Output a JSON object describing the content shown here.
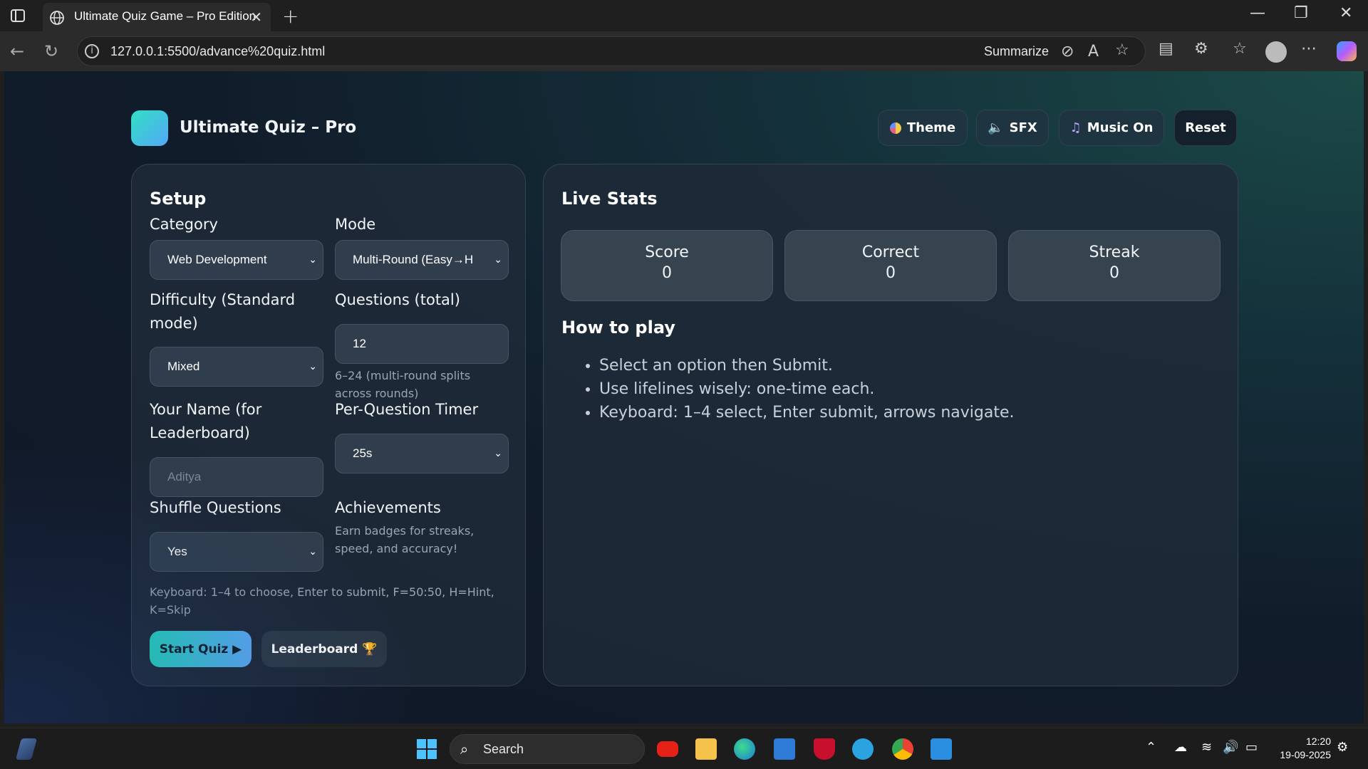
{
  "browser": {
    "tab_title": "Ultimate Quiz Game – Pro Edition",
    "tab_close": "✕",
    "new_tab": "+",
    "url": "127.0.0.1:5500/advance%20quiz.html",
    "summarize_label": "Summarize",
    "window_controls": [
      "—",
      "❐",
      "✕"
    ]
  },
  "app": {
    "title": "Ultimate Quiz – Pro",
    "header_buttons": {
      "theme": "Theme",
      "sfx": "SFX",
      "music": "Music On",
      "reset": "Reset"
    }
  },
  "setup": {
    "heading": "Setup",
    "category_label": "Category",
    "category_value": "Web Development",
    "mode_label": "Mode",
    "mode_value": "Multi-Round (Easy→H",
    "difficulty_label": "Difficulty (Standard mode)",
    "difficulty_value": "Mixed",
    "questions_label": "Questions (total)",
    "questions_value": "12",
    "questions_hint": "6–24 (multi-round splits across rounds)",
    "name_label": "Your Name (for Leaderboard)",
    "name_placeholder": "Aditya",
    "timer_label": "Per-Question Timer",
    "timer_value": "25s",
    "shuffle_label": "Shuffle Questions",
    "shuffle_value": "Yes",
    "achievements_label": "Achievements",
    "achievements_hint": "Earn badges for streaks, speed, and accuracy!",
    "keyboard_hint": "Keyboard: 1–4 to choose, Enter to submit, F=50:50, H=Hint, K=Skip",
    "start_button": "Start Quiz ▶",
    "leaderboard_button": "Leaderboard"
  },
  "stats": {
    "heading": "Live Stats",
    "items": [
      {
        "label": "Score",
        "value": "0"
      },
      {
        "label": "Correct",
        "value": "0"
      },
      {
        "label": "Streak",
        "value": "0"
      }
    ],
    "howto_heading": "How to play",
    "howto": [
      "Select an option then Submit.",
      "Use lifelines wisely: one-time each.",
      "Keyboard: 1–4 select, Enter submit, arrows navigate."
    ]
  },
  "taskbar": {
    "search_label": "Search",
    "time": "12:20",
    "date": "19-09-2025"
  },
  "colors": {
    "accent_start": "#24d7c0",
    "accent_end": "#5aa9f5",
    "card_bg": "#1e2a38"
  }
}
